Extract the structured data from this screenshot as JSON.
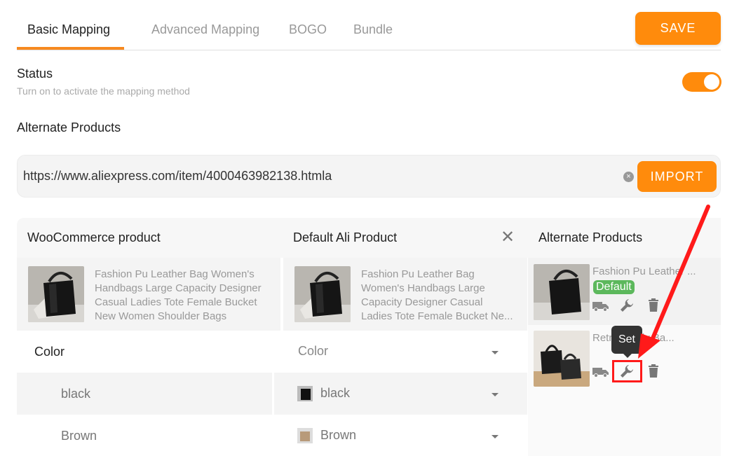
{
  "tabs": [
    {
      "label": "Basic Mapping",
      "active": true
    },
    {
      "label": "Advanced Mapping",
      "active": false
    },
    {
      "label": "BOGO",
      "active": false
    },
    {
      "label": "Bundle",
      "active": false
    }
  ],
  "toolbar": {
    "save_label": "SAVE"
  },
  "status": {
    "title": "Status",
    "subtitle": "Turn on to activate the mapping method",
    "enabled": true
  },
  "alternate": {
    "title": "Alternate Products",
    "url_value": "https://www.aliexpress.com/item/4000463982138.htmla",
    "import_label": "IMPORT"
  },
  "table": {
    "col_woo": "WooCommerce product",
    "col_default": "Default Ali Product",
    "col_alt": "Alternate Products",
    "woo_product": {
      "line1": "Fashion Pu Leather Bag Women's",
      "line2": "Handbags Large Capacity Designer",
      "line3": "Casual Ladies Tote Female Bucket",
      "line4": "New Women Shoulder Bags"
    },
    "default_product": {
      "line1": "Fashion Pu Leather Bag",
      "line2": "Women's Handbags Large",
      "line3": "Capacity Designer Casual",
      "line4": "Ladies Tote Female Bucket Ne..."
    },
    "attribute": {
      "name": "Color",
      "selected": "Color"
    },
    "variants": [
      {
        "name": "black",
        "selected": "black"
      },
      {
        "name": "Brown",
        "selected": "Brown"
      }
    ]
  },
  "alt_products": [
    {
      "name": "Fashion Pu Leather ...",
      "badge": "Default"
    },
    {
      "name": "Retro ... ody Ba...",
      "badge": ""
    }
  ],
  "tooltip": {
    "text": "Set"
  },
  "colors": {
    "accent": "#ff8b0c",
    "badge": "#5cb85c",
    "highlight": "#ff1a1a"
  }
}
